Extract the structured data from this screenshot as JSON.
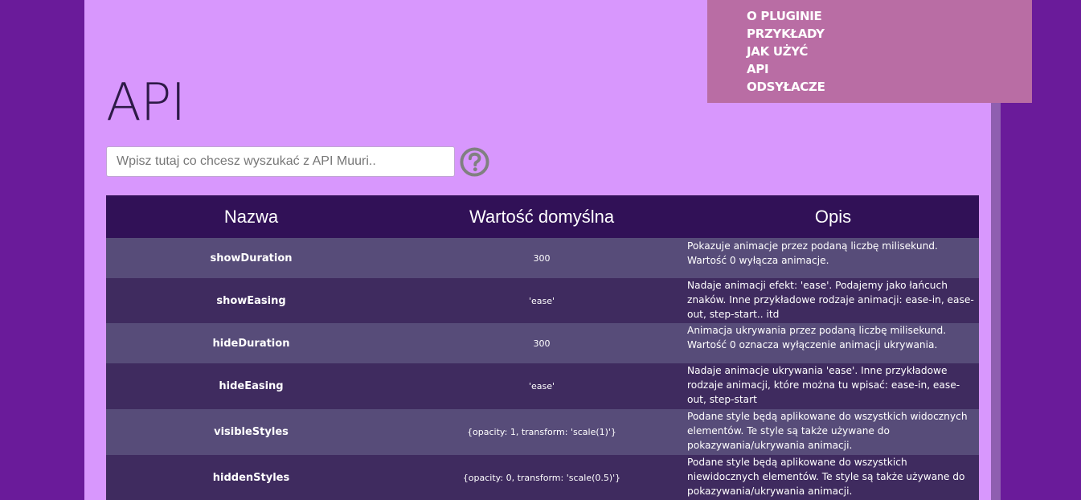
{
  "nav": {
    "items": [
      "O PLUGINIE",
      "PRZYKŁADY",
      "JAK UŻYĆ",
      "API",
      "ODSYŁACZE"
    ]
  },
  "page": {
    "title": "API"
  },
  "search": {
    "placeholder": "Wpisz tutaj co chcesz wyszukać z API Muuri.."
  },
  "help": {
    "icon": "question-circle-icon"
  },
  "table": {
    "headers": [
      "Nazwa",
      "Wartość domyślna",
      "Opis"
    ],
    "rows": [
      {
        "name": "showDuration",
        "default": "300",
        "desc": "Pokazuje animacje przez podaną liczbę milisekund. Wartość 0 wyłącza animacje."
      },
      {
        "name": "showEasing",
        "default": "'ease'",
        "desc": "Nadaje animacji efekt: 'ease'. Podajemy jako łańcuch znaków. Inne przykładowe rodzaje animacji: ease-in, ease-out, step-start.. itd"
      },
      {
        "name": "hideDuration",
        "default": "300",
        "desc": "Animacja ukrywania przez podaną liczbę milisekund. Wartość 0 oznacza wyłączenie animacji ukrywania."
      },
      {
        "name": "hideEasing",
        "default": "'ease'",
        "desc": "Nadaje animacje ukrywania 'ease'. Inne przykładowe rodzaje animacji, które można tu wpisać: ease-in, ease-out, step-start"
      },
      {
        "name": "visibleStyles",
        "default": "{opacity: 1, transform: 'scale(1)'}",
        "desc": "Podane style będą aplikowane do wszystkich widocznych elementów. Te style są także używane do pokazywania/ukrywania animacji."
      },
      {
        "name": "hiddenStyles",
        "default": "{opacity: 0, transform: 'scale(0.5)'}",
        "desc": "Podane style będą aplikowane do wszystkich niewidocznych elementów. Te style są także używane do pokazywania/ukrywania animacji."
      }
    ]
  },
  "colors": {
    "outer_background": "#6a1b9a",
    "page_background": "#d897fd",
    "nav_background": "#b96da4",
    "table_header": "#311157",
    "row_odd": "#574c79",
    "row_even": "#3f2b5f"
  }
}
